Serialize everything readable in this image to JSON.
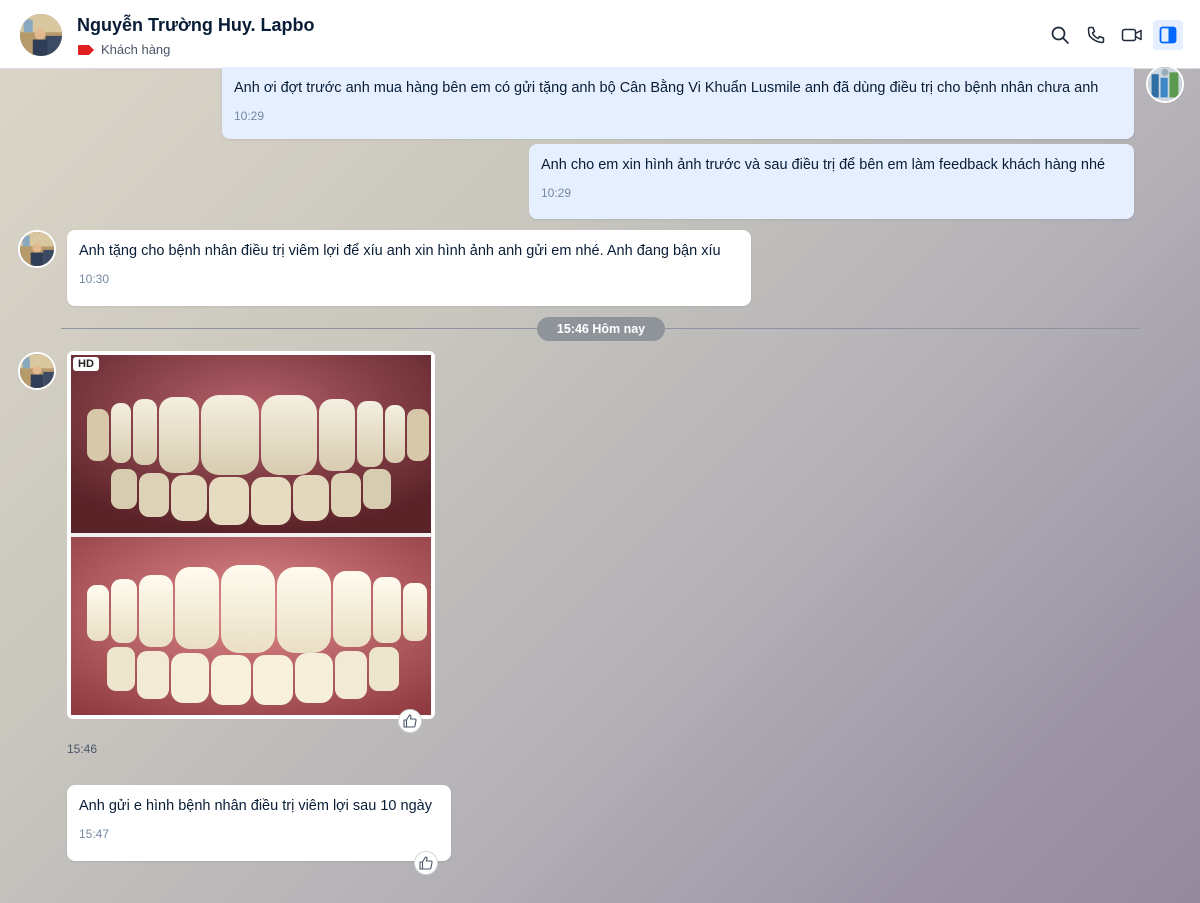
{
  "header": {
    "contact_name": "Nguyễn Trường Huy. Lapbo",
    "tag_label": "Khách hàng",
    "tag_color": "#e02020",
    "actions": [
      "search-icon",
      "phone-icon",
      "video-icon",
      "sidebar-toggle-icon"
    ]
  },
  "messages": [
    {
      "from": "me",
      "text": "Anh ơi đợt trước anh mua hàng bên em có gửi tặng anh bộ Cân Bằng Vi Khuẩn Lusmile anh đã dùng điều trị cho bệnh nhân chưa anh",
      "time": "10:29"
    },
    {
      "from": "me",
      "text": "Anh cho em xin hình ảnh trước và sau điều trị để bên em làm feedback khách hàng nhé",
      "time": "10:29"
    },
    {
      "from": "contact",
      "text": "Anh tặng cho bệnh nhân điều trị viêm lợi để xíu anh xin hình ảnh anh gửi em nhé. Anh đang bận xíu",
      "time": "10:30"
    }
  ],
  "divider": {
    "label": "15:46 Hôm nay"
  },
  "image_message": {
    "badge": "HD",
    "time": "15:46"
  },
  "last_message": {
    "text": "Anh gửi e hình bệnh nhân điều trị viêm lợi sau 10 ngày",
    "time": "15:47"
  },
  "colors": {
    "my_bubble": "#e5efff",
    "their_bubble": "#ffffff",
    "accent": "#0068ff"
  }
}
